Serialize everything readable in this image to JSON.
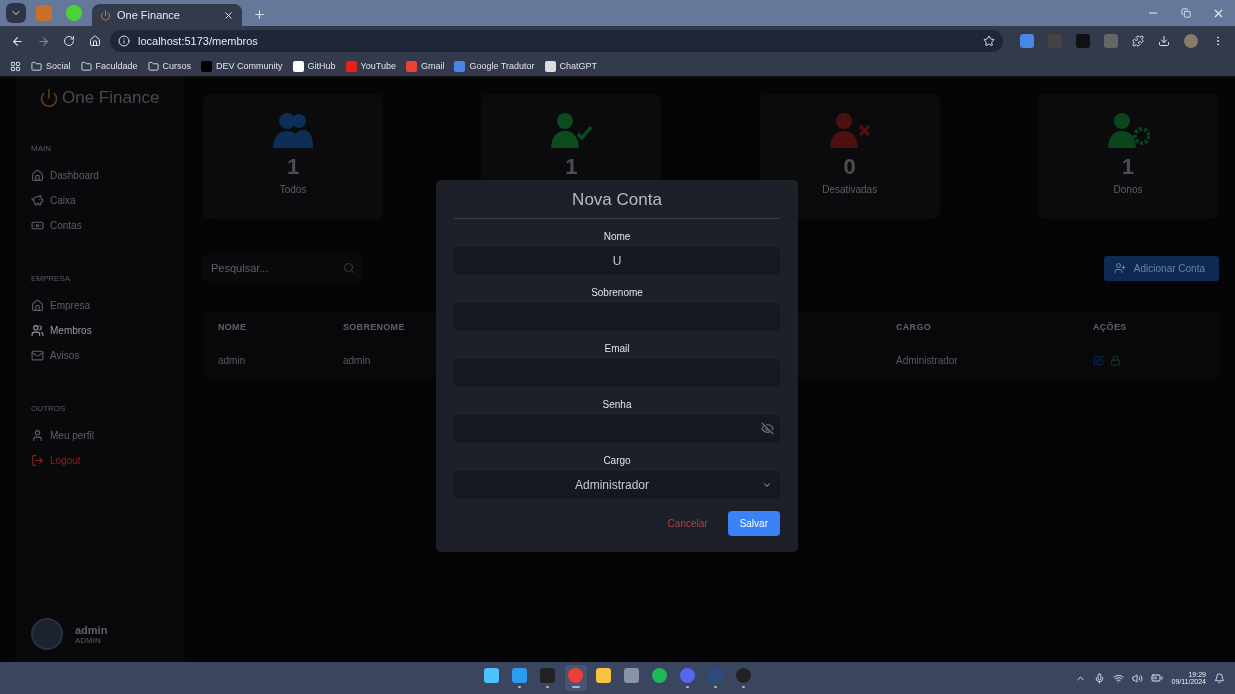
{
  "browser": {
    "pinned_tabs": [
      {
        "kind": "sail"
      },
      {
        "kind": "green"
      }
    ],
    "tabs": [
      {
        "title": "One Finance",
        "selected": true
      }
    ],
    "address": "localhost:5173/membros",
    "bookmarks": [
      {
        "kind": "folder",
        "label": "Social"
      },
      {
        "kind": "folder",
        "label": "Faculdade"
      },
      {
        "kind": "folder",
        "label": "Cursos"
      },
      {
        "kind": "dev",
        "label": "DEV Community"
      },
      {
        "kind": "github",
        "label": "GitHub"
      },
      {
        "kind": "youtube",
        "label": "YouTube"
      },
      {
        "kind": "gmail",
        "label": "Gmail"
      },
      {
        "kind": "translate",
        "label": "Google Tradutor"
      },
      {
        "kind": "chatgpt",
        "label": "ChatGPT"
      }
    ]
  },
  "sidebar": {
    "brand": "One Finance",
    "sections": [
      {
        "title": "MAIN",
        "items": [
          {
            "kind": "home",
            "label": "Dashboard",
            "selected": false
          },
          {
            "kind": "piggy",
            "label": "Caixa",
            "selected": false
          },
          {
            "kind": "money",
            "label": "Contas",
            "selected": false
          }
        ]
      },
      {
        "title": "EMPRESA",
        "items": [
          {
            "kind": "home",
            "label": "Empresa",
            "selected": false
          },
          {
            "kind": "users",
            "label": "Membros",
            "selected": true
          },
          {
            "kind": "mail",
            "label": "Avisos",
            "selected": false
          }
        ]
      },
      {
        "title": "OUTROS",
        "items": [
          {
            "kind": "user",
            "label": "Meu perfil",
            "selected": false
          },
          {
            "kind": "logout",
            "label": "Logout",
            "selected": false
          }
        ]
      }
    ],
    "user": {
      "name": "admin",
      "role": "ADMIN"
    }
  },
  "stats": [
    {
      "kind": "all",
      "value": "1",
      "label": "Todos"
    },
    {
      "kind": "active",
      "value": "1"
    },
    {
      "kind": "disabled",
      "value": "0",
      "label": "Desativadas"
    },
    {
      "kind": "owners",
      "value": "1",
      "label": "Donos"
    }
  ],
  "search": {
    "placeholder": "Pesquisar..."
  },
  "add_button": "Adicionar Conta",
  "table": {
    "columns": [
      "NOME",
      "SOBRENOME",
      "CARGO",
      "AÇÕES"
    ],
    "rows": [
      {
        "cells": [
          "admin",
          "admin",
          "Administrador"
        ]
      }
    ]
  },
  "modal": {
    "title": "Nova Conta",
    "fields": [
      {
        "kind": "text",
        "label": "Nome",
        "value": "U"
      },
      {
        "kind": "text",
        "label": "Sobrenome"
      },
      {
        "kind": "text",
        "label": "Email"
      },
      {
        "kind": "password",
        "label": "Senha"
      },
      {
        "kind": "select",
        "label": "Cargo",
        "value": "Administrador"
      }
    ],
    "cancel": "Cancelar",
    "save": "Salvar"
  },
  "taskbar": {
    "apps": [
      {
        "kind": "start",
        "running": false,
        "selected": false
      },
      {
        "kind": "vscode",
        "running": true,
        "selected": false
      },
      {
        "kind": "terminal",
        "running": true,
        "selected": false
      },
      {
        "kind": "chrome",
        "running": true,
        "selected": true
      },
      {
        "kind": "files",
        "running": false,
        "selected": false
      },
      {
        "kind": "settings",
        "running": false,
        "selected": false
      },
      {
        "kind": "spotify",
        "running": false,
        "selected": false
      },
      {
        "kind": "discord",
        "running": true,
        "selected": false
      },
      {
        "kind": "studio",
        "running": true,
        "selected": false
      },
      {
        "kind": "obs",
        "running": true,
        "selected": false
      }
    ],
    "time": "19:29",
    "date": "09/11/2024"
  }
}
